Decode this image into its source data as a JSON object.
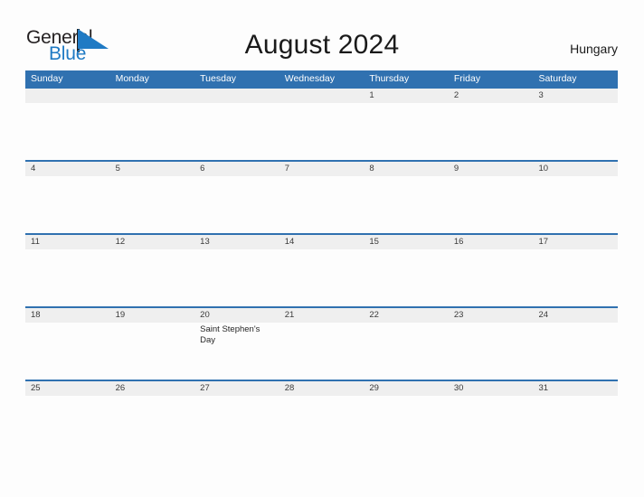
{
  "brand": {
    "name_part1": "General",
    "name_part2": "Blue",
    "flag_icon": "blue-triangle-flag-icon",
    "color_dark": "#231f20",
    "color_blue": "#1f7ac4"
  },
  "header": {
    "title": "August 2024",
    "country": "Hungary"
  },
  "colors": {
    "header_blue": "#3071b0",
    "date_band_gray": "#efefef",
    "page_background": "#fdfdfd",
    "rule_blue": "#3071b0"
  },
  "calendar": {
    "month": "August",
    "year": "2024",
    "weekdays": [
      "Sunday",
      "Monday",
      "Tuesday",
      "Wednesday",
      "Thursday",
      "Friday",
      "Saturday"
    ],
    "weeks": [
      {
        "dates": [
          "",
          "",
          "",
          "",
          "1",
          "2",
          "3"
        ],
        "events": [
          "",
          "",
          "",
          "",
          "",
          "",
          ""
        ]
      },
      {
        "dates": [
          "4",
          "5",
          "6",
          "7",
          "8",
          "9",
          "10"
        ],
        "events": [
          "",
          "",
          "",
          "",
          "",
          "",
          ""
        ]
      },
      {
        "dates": [
          "11",
          "12",
          "13",
          "14",
          "15",
          "16",
          "17"
        ],
        "events": [
          "",
          "",
          "",
          "",
          "",
          "",
          ""
        ]
      },
      {
        "dates": [
          "18",
          "19",
          "20",
          "21",
          "22",
          "23",
          "24"
        ],
        "events": [
          "",
          "",
          "Saint Stephen's Day",
          "",
          "",
          "",
          ""
        ]
      },
      {
        "dates": [
          "25",
          "26",
          "27",
          "28",
          "29",
          "30",
          "31"
        ],
        "events": [
          "",
          "",
          "",
          "",
          "",
          "",
          ""
        ]
      }
    ]
  }
}
